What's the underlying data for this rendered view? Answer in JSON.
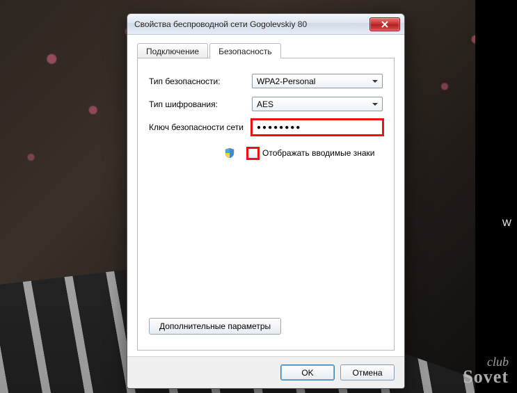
{
  "window": {
    "title": "Свойства беспроводной сети Gogolevskiy 80"
  },
  "tabs": [
    {
      "label": "Подключение"
    },
    {
      "label": "Безопасность"
    }
  ],
  "form": {
    "security_type_label": "Тип безопасности:",
    "security_type_value": "WPA2-Personal",
    "encryption_label": "Тип шифрования:",
    "encryption_value": "AES",
    "key_label": "Ключ безопасности сети",
    "key_value": "●●●●●●●●",
    "show_chars_label": "Отображать вводимые знаки",
    "advanced_button": "Дополнительные параметры"
  },
  "footer": {
    "ok": "OK",
    "cancel": "Отмена"
  },
  "watermark": {
    "line1": "club",
    "line2": "Sovet"
  },
  "stray_text": "W"
}
